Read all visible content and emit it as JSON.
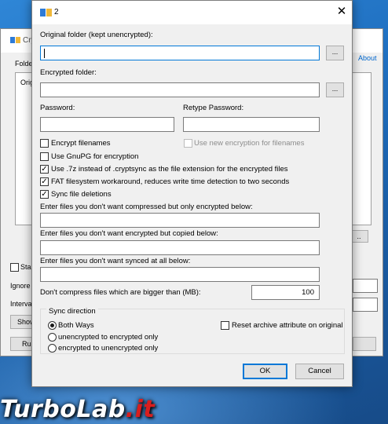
{
  "background_window": {
    "title": "Cry",
    "about_link": "About",
    "folder_label": "Folde",
    "orig_label": "Orig",
    "dots_label": "..",
    "start_label": "Star",
    "ignore_label": "Ignore",
    "interval_label": "Interva",
    "show_label": "Show",
    "run_label": "Ru"
  },
  "dialog": {
    "title": "2",
    "original_folder_label": "Original folder (kept unencrypted):",
    "original_folder_value": "",
    "browse_label": "...",
    "encrypted_folder_label": "Encrypted folder:",
    "encrypted_folder_value": "",
    "password_label": "Password:",
    "retype_password_label": "Retype Password:",
    "checkboxes": [
      {
        "label": "Encrypt filenames",
        "checked": false
      },
      {
        "label": "Use new encryption for filenames",
        "checked": false,
        "disabled": true
      },
      {
        "label": "Use GnuPG for encryption",
        "checked": false
      },
      {
        "label": "Use .7z instead of .cryptsync as the file extension for the encrypted files",
        "checked": true
      },
      {
        "label": "FAT filesystem workaround, reduces write time detection to two seconds",
        "checked": true
      },
      {
        "label": "Sync file deletions",
        "checked": true
      }
    ],
    "compressed_only_label": "Enter files you don't want compressed but only encrypted below:",
    "copied_label": "Enter files you don't want encrypted but copied below:",
    "not_synced_label": "Enter files you don't want synced at all below:",
    "max_size_label": "Don't compress files which are bigger than (MB):",
    "max_size_value": "100",
    "sync_direction": {
      "legend": "Sync direction",
      "options": [
        "Both Ways",
        "unencrypted to encrypted only",
        "encrypted to unencrypted only"
      ],
      "selected": "Both Ways"
    },
    "reset_archive_label": "Reset archive attribute on original",
    "ok_label": "OK",
    "cancel_label": "Cancel"
  },
  "watermark": {
    "part1": "TurboLab",
    "part2": ".it"
  },
  "colors": {
    "accent": "#0078d7",
    "desktop": "#1f6fc0",
    "watermark_red": "#d81e1e"
  }
}
